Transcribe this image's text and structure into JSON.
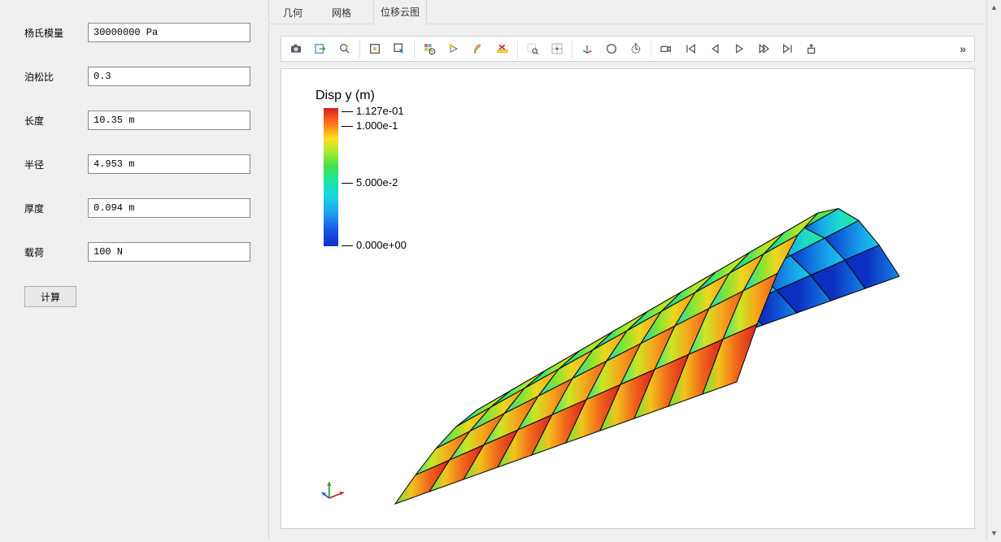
{
  "form": {
    "fields": [
      {
        "label": "杨氏模量",
        "value": "30000000 Pa"
      },
      {
        "label": "泊松比",
        "value": "0.3"
      },
      {
        "label": "长度",
        "value": "10.35 m"
      },
      {
        "label": "半径",
        "value": "4.953 m"
      },
      {
        "label": "厚度",
        "value": "0.094 m"
      },
      {
        "label": "载荷",
        "value": "100 N"
      }
    ],
    "calc_label": "计算"
  },
  "tabs": {
    "items": [
      "几何",
      "网格",
      "位移云图"
    ],
    "active_index": 2
  },
  "toolbar": {
    "icons": [
      "snapshot-icon",
      "export-icon",
      "zoom-flash-icon",
      "select-box-icon",
      "select-arrow-icon",
      "grid-settings-icon",
      "lightbulb-icon",
      "brush-icon",
      "ruler-x-icon",
      "zoom-rect-icon",
      "select-center-icon",
      "rotate-axes-icon",
      "orbit-icon",
      "timer-icon",
      "camera-icon",
      "skip-first-icon",
      "step-back-icon",
      "play-icon",
      "step-fwd-icon",
      "skip-last-icon",
      "export-anim-icon"
    ],
    "more": "»"
  },
  "legend": {
    "title": "Disp y (m)",
    "ticks": [
      {
        "pos": 0,
        "label": "1.127e-01"
      },
      {
        "pos": 18,
        "label": "1.000e-1"
      },
      {
        "pos": 88,
        "label": "5.000e-2"
      },
      {
        "pos": 165,
        "label": "0.000e+00"
      }
    ]
  },
  "chart_data": {
    "type": "heatmap",
    "title": "Disp y (m)",
    "colorbar_label": "Disp y (m)",
    "range": [
      0.0,
      0.1127
    ],
    "ticks": [
      0.0,
      0.05,
      0.1,
      0.1127
    ],
    "grid_dims": {
      "rows": 8,
      "cols": 10
    },
    "description": "3D surface displacement contour (y-displacement) over a curved shell; color varies from ~0 (blue, near edge) to ~0.1127 m (red, far corner)."
  }
}
